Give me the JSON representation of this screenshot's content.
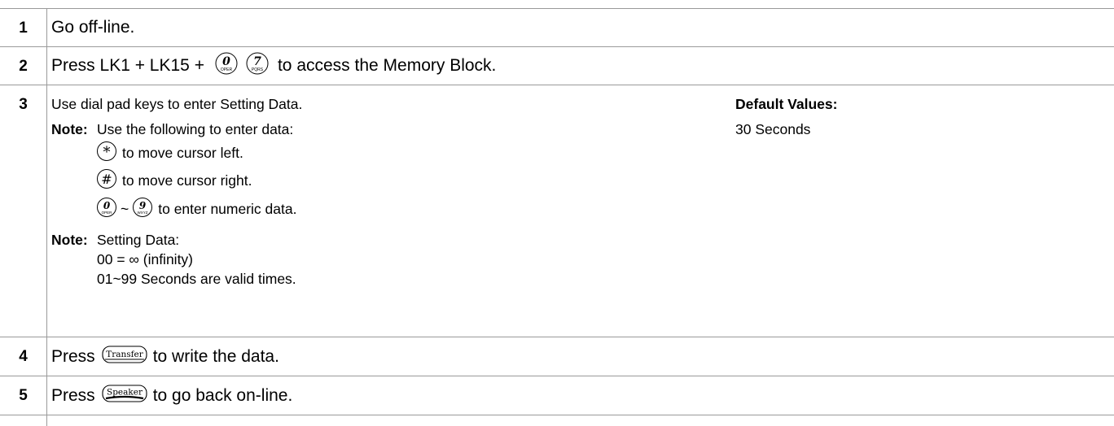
{
  "steps": [
    {
      "num": "1",
      "text": "Go off-line."
    },
    {
      "num": "2",
      "pre": "Press LK1 + LK15 +",
      "post": "to access the Memory Block.",
      "keys": [
        {
          "digit": "0",
          "letters": "OPER"
        },
        {
          "digit": "7",
          "letters": "PQRS"
        }
      ]
    },
    {
      "num": "3",
      "line1": "Use dial pad keys to enter Setting Data.",
      "note_label": "Note:",
      "note1_text": "Use the following to enter data:",
      "star_key": "*",
      "star_text": "to move cursor left.",
      "hash_key": "#",
      "hash_text": "to move cursor right.",
      "range_from": {
        "digit": "0",
        "letters": "OPER"
      },
      "range_sep": "~",
      "range_to": {
        "digit": "9",
        "letters": "WXYZ"
      },
      "range_text": "to enter numeric data.",
      "note2_text": "Setting Data:",
      "sd_line1": "00 = ∞ (infinity)",
      "sd_line2": "01~99 Seconds are valid times.",
      "default_label": "Default Values:",
      "default_value": "30 Seconds"
    },
    {
      "num": "4",
      "pre": "Press",
      "key": "Transfer",
      "post": "to write the data."
    },
    {
      "num": "5",
      "pre": "Press",
      "key": "Speaker",
      "post": "to go back on-line."
    }
  ],
  "colors": {
    "border": "#9a9a9a",
    "text": "#000000",
    "background": "#ffffff"
  },
  "icons": [
    "dial-key-icon",
    "star-key-icon",
    "hash-key-icon",
    "transfer-key-icon",
    "speaker-key-icon"
  ]
}
